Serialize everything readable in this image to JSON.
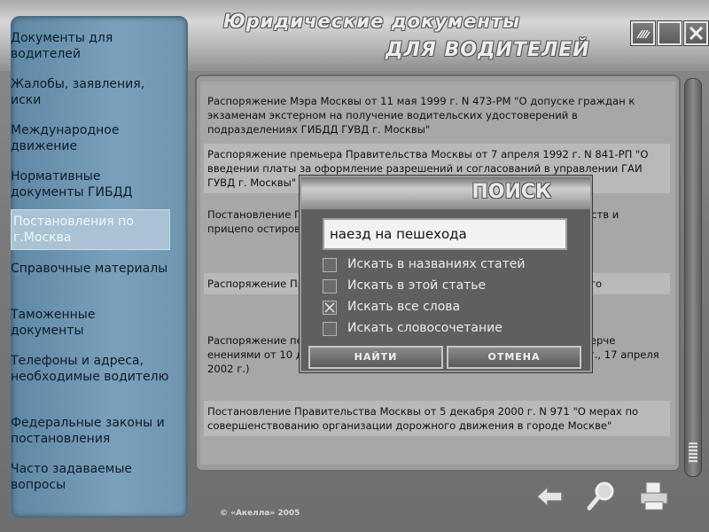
{
  "app": {
    "title_line1": "Юридические документы",
    "title_line2": "ДЛЯ ВОДИТЕЛЕЙ",
    "copyright": "© «Акелла» 2005"
  },
  "window_buttons": [
    {
      "name": "settings",
      "icon": "grid-icon"
    },
    {
      "name": "minimize",
      "icon": "minimize-icon"
    },
    {
      "name": "close",
      "icon": "close-icon"
    }
  ],
  "sidebar": {
    "items": [
      {
        "label": "Документы для водителей"
      },
      {
        "label": "Жалобы, заявления, иски"
      },
      {
        "label": "Международное движение"
      },
      {
        "label": "Нормативные документы ГИБДД"
      },
      {
        "label": "Постановления по г.Москва",
        "active": true
      },
      {
        "label": "Справочные материалы"
      },
      {
        "label": "Таможенные документы"
      },
      {
        "label": "Телефоны и адреса, необходимые водителю"
      },
      {
        "label": "Федеральные законы и постановления"
      },
      {
        "label": "Часто задаваемые вопросы"
      }
    ]
  },
  "documents": [
    {
      "text": "Распоряжение Мэра Москвы от 11 мая 1999 г. N 473-РМ \"О допуске граждан к экзаменам экстерном на получение водительских удостоверений в подразделениях ГИБДД ГУВД г. Москвы\""
    },
    {
      "text": "Распоряжение премьера Правительства Москвы от 7 апреля 1992 г. N 841-РП \"О введении платы за оформление разрешений и согласований в управлении ГАИ ГУВД г. Москвы\" (с измене"
    },
    {
      "text": "Постановление Пр                                              финансовом обеспечении прове                                              ранспортных средств и прицепо                                              остирования в г.Москве\""
    },
    {
      "text": "Распоряжение Пр                                              мерах по обеспечению безо                                              тацию участках Третьего"
    },
    {
      "text": "Распоряжение пе                                              20 апреля 1998 г. N 336-РЗП                                              аселения Москвы коммерче                                              енениями от 10 декабря 1998 г., 18 октября 1999 г., 7 сентября 2001 г., 17 апреля 2002 г.)"
    },
    {
      "text": "Постановление Правительства Москвы от 5 декабря 2000 г. N 971 \"О мерах по совершенствованию организации дорожного движения в городе Москве\""
    }
  ],
  "search_dialog": {
    "title": "ПОИСК",
    "query": "наезд на пешехода",
    "options": [
      {
        "label": "Искать в названиях статей",
        "checked": false
      },
      {
        "label": "Искать в этой статье",
        "checked": false
      },
      {
        "label": "Искать все слова",
        "checked": true
      },
      {
        "label": "Искать словосочетание",
        "checked": false
      }
    ],
    "ok_label": "НАЙТИ",
    "cancel_label": "ОТМЕНА"
  },
  "toolbar": [
    {
      "name": "back",
      "icon": "arrow-left-icon"
    },
    {
      "name": "search",
      "icon": "magnifier-icon"
    },
    {
      "name": "print",
      "icon": "printer-icon"
    }
  ]
}
